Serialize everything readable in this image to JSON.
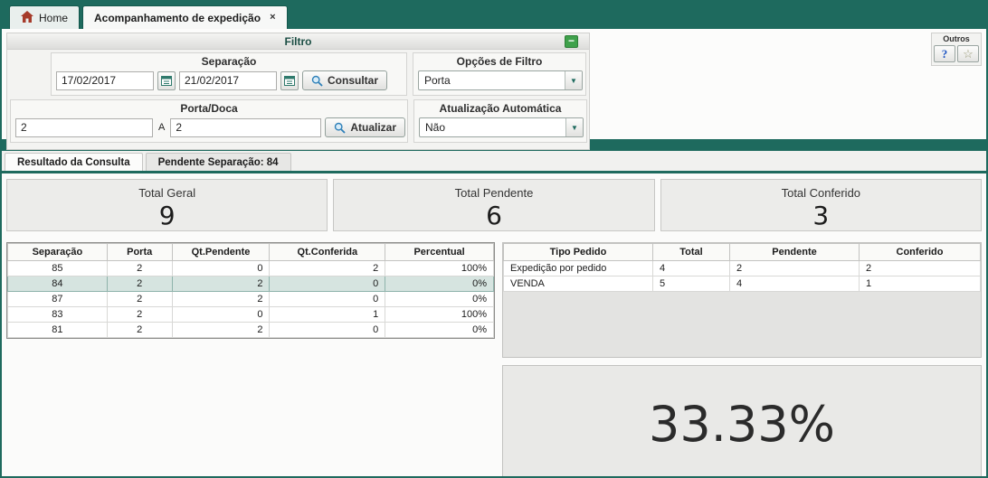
{
  "window_tabs": {
    "home_label": "Home",
    "main_label": "Acompanhamento de expedição",
    "close_glyph": "×"
  },
  "filter": {
    "title": "Filtro",
    "collapse_glyph": "−",
    "separacao": {
      "title": "Separação",
      "date_from": "17/02/2017",
      "date_to": "21/02/2017",
      "consultar_label": "Consultar"
    },
    "opcoes_filtro": {
      "title": "Opções de Filtro",
      "value": "Porta"
    },
    "porta_doca": {
      "title": "Porta/Doca",
      "from": "2",
      "separator": "A",
      "to": "2",
      "atualizar_label": "Atualizar"
    },
    "atualizacao_automatica": {
      "title": "Atualização Automática",
      "value": "Não"
    },
    "outros": {
      "title": "Outros",
      "help_glyph": "?",
      "star_glyph": "☆"
    }
  },
  "result_tabs": [
    {
      "label": "Resultado da Consulta"
    },
    {
      "label": "Pendente Separação: 84"
    }
  ],
  "summary_cards": [
    {
      "label": "Total Geral",
      "value": "9"
    },
    {
      "label": "Total Pendente",
      "value": "6"
    },
    {
      "label": "Total Conferido",
      "value": "3"
    }
  ],
  "separacao_table": {
    "headers": [
      "Separação",
      "Porta",
      "Qt.Pendente",
      "Qt.Conferida",
      "Percentual"
    ],
    "rows": [
      [
        "85",
        "2",
        "0",
        "2",
        "100%"
      ],
      [
        "84",
        "2",
        "2",
        "0",
        "0%"
      ],
      [
        "87",
        "2",
        "2",
        "0",
        "0%"
      ],
      [
        "83",
        "2",
        "0",
        "1",
        "100%"
      ],
      [
        "81",
        "2",
        "2",
        "0",
        "0%"
      ]
    ],
    "selected_row_index": 1
  },
  "tipo_pedido_table": {
    "headers": [
      "Tipo Pedido",
      "Total",
      "Pendente",
      "Conferido"
    ],
    "rows": [
      [
        "Expedição por pedido",
        "4",
        "2",
        "2"
      ],
      [
        "VENDA",
        "5",
        "4",
        "1"
      ]
    ]
  },
  "percentual_conferido": "33.33%",
  "colors": {
    "brand_teal": "#1e6a5e",
    "selected_row": "#d6e4e0",
    "collapse_green": "#3fa14b",
    "home_icon_red": "#a63b2a"
  }
}
